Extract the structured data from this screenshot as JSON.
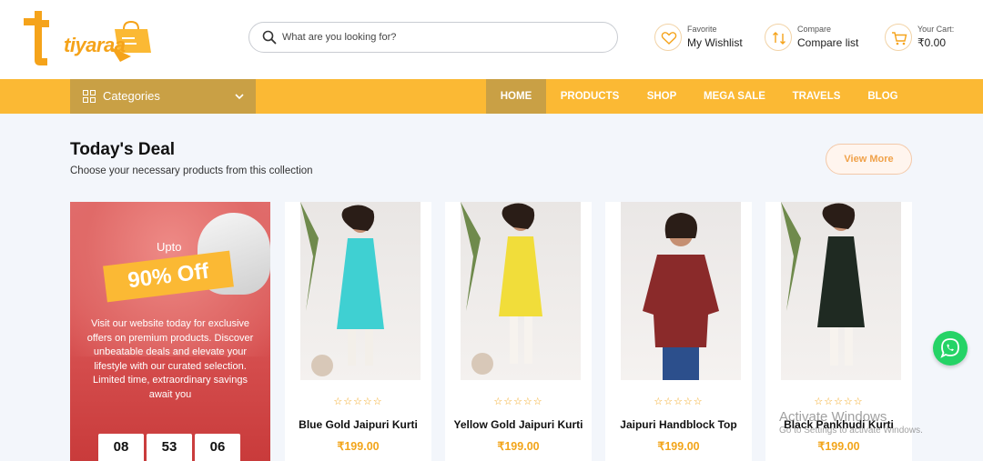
{
  "brand": {
    "name": "tiyaraa",
    "accent": "#fbb934",
    "accent_dark": "#c9a045"
  },
  "search": {
    "placeholder": "What are you looking for?",
    "icon": "search-icon"
  },
  "header": {
    "wishlist": {
      "small": "Favorite",
      "big": "My Wishlist",
      "icon": "heart-icon"
    },
    "compare": {
      "small": "Compare",
      "big": "Compare list",
      "icon": "compare-icon"
    },
    "cart": {
      "small": "Your Cart:",
      "big": "₹0.00",
      "icon": "cart-icon"
    }
  },
  "nav": {
    "categories_label": "Categories",
    "links": [
      "HOME",
      "PRODUCTS",
      "SHOP",
      "MEGA SALE",
      "TRAVELS",
      "BLOG"
    ],
    "active": "HOME"
  },
  "section": {
    "title": "Today's Deal",
    "subtitle": "Choose your necessary products from this collection",
    "view_more": "View More"
  },
  "promo": {
    "upto": "Upto",
    "discount": "90% Off",
    "description": "Visit our website today for exclusive offers on premium products. Discover unbeatable deals and elevate your lifestyle with our curated selection. Limited time, extraordinary savings await you",
    "timer": [
      "08",
      "53",
      "06"
    ]
  },
  "products": [
    {
      "name": "Blue Gold Jaipuri Kurti",
      "price": "₹199.00",
      "stars": "☆☆☆☆☆",
      "color": "#3fd0d2"
    },
    {
      "name": "Yellow Gold Jaipuri Kurti",
      "price": "₹199.00",
      "stars": "☆☆☆☆☆",
      "color": "#f1dd3a"
    },
    {
      "name": "Jaipuri Handblock Top",
      "price": "₹199.00",
      "stars": "☆☆☆☆☆",
      "color": "#8a2a2a"
    },
    {
      "name": "Black Pankhudi Kurti",
      "price": "₹199.00",
      "stars": "☆☆☆☆☆",
      "color": "#1f2a22"
    }
  ],
  "overlay": {
    "activate_title": "Activate Windows",
    "activate_sub": "Go to Settings to activate Windows."
  }
}
